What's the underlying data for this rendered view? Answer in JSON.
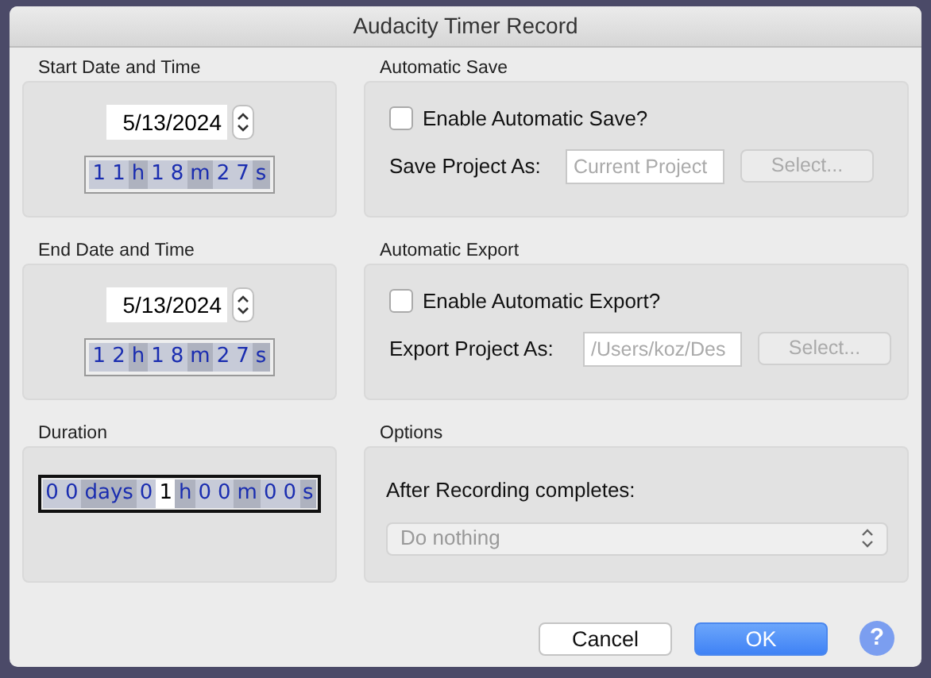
{
  "window": {
    "title": "Audacity Timer Record"
  },
  "start": {
    "label": "Start Date and Time",
    "date": "5/13/2024",
    "focused": false,
    "time": [
      {
        "text": "1",
        "kind": "digit",
        "selected": false
      },
      {
        "text": "1",
        "kind": "digit",
        "selected": false
      },
      {
        "text": "h",
        "kind": "unit",
        "selected": false
      },
      {
        "text": "1",
        "kind": "digit",
        "selected": false
      },
      {
        "text": "8",
        "kind": "digit",
        "selected": false
      },
      {
        "text": "m",
        "kind": "unit",
        "selected": false
      },
      {
        "text": "2",
        "kind": "digit",
        "selected": false
      },
      {
        "text": "7",
        "kind": "digit",
        "selected": false
      },
      {
        "text": "s",
        "kind": "unit",
        "selected": false
      }
    ]
  },
  "automatic_save": {
    "label": "Automatic Save",
    "checkbox": {
      "label": "Enable Automatic Save?",
      "checked": false
    },
    "field_label": "Save Project As:",
    "field": {
      "value": "Current Project",
      "disabled": true
    },
    "button": {
      "label": "Select...",
      "disabled": true
    }
  },
  "end": {
    "label": "End Date and Time",
    "date": "5/13/2024",
    "focused": false,
    "time": [
      {
        "text": "1",
        "kind": "digit",
        "selected": false
      },
      {
        "text": "2",
        "kind": "digit",
        "selected": false
      },
      {
        "text": "h",
        "kind": "unit",
        "selected": false
      },
      {
        "text": "1",
        "kind": "digit",
        "selected": false
      },
      {
        "text": "8",
        "kind": "digit",
        "selected": false
      },
      {
        "text": "m",
        "kind": "unit",
        "selected": false
      },
      {
        "text": "2",
        "kind": "digit",
        "selected": false
      },
      {
        "text": "7",
        "kind": "digit",
        "selected": false
      },
      {
        "text": "s",
        "kind": "unit",
        "selected": false
      }
    ]
  },
  "automatic_export": {
    "label": "Automatic Export",
    "checkbox": {
      "label": "Enable Automatic Export?",
      "checked": false
    },
    "field_label": "Export Project As:",
    "field": {
      "value": "/Users/koz/Des",
      "disabled": true
    },
    "button": {
      "label": "Select...",
      "disabled": true
    }
  },
  "duration": {
    "label": "Duration",
    "focused": true,
    "time": [
      {
        "text": "0",
        "kind": "digit",
        "selected": false
      },
      {
        "text": "0",
        "kind": "digit",
        "selected": false
      },
      {
        "text": "days",
        "kind": "unit",
        "selected": false
      },
      {
        "text": "0",
        "kind": "digit",
        "selected": false
      },
      {
        "text": "1",
        "kind": "digit",
        "selected": true
      },
      {
        "text": "h",
        "kind": "unit",
        "selected": false
      },
      {
        "text": "0",
        "kind": "digit",
        "selected": false
      },
      {
        "text": "0",
        "kind": "digit",
        "selected": false
      },
      {
        "text": "m",
        "kind": "unit",
        "selected": false
      },
      {
        "text": "0",
        "kind": "digit",
        "selected": false
      },
      {
        "text": "0",
        "kind": "digit",
        "selected": false
      },
      {
        "text": "s",
        "kind": "unit",
        "selected": false
      }
    ]
  },
  "options": {
    "label": "Options",
    "prompt": "After Recording completes:",
    "select": {
      "value": "Do nothing",
      "disabled": true
    }
  },
  "buttons": [
    {
      "label": "Cancel",
      "kind": "cancel"
    },
    {
      "label": "OK",
      "kind": "default"
    }
  ],
  "help": {
    "label": "?"
  }
}
